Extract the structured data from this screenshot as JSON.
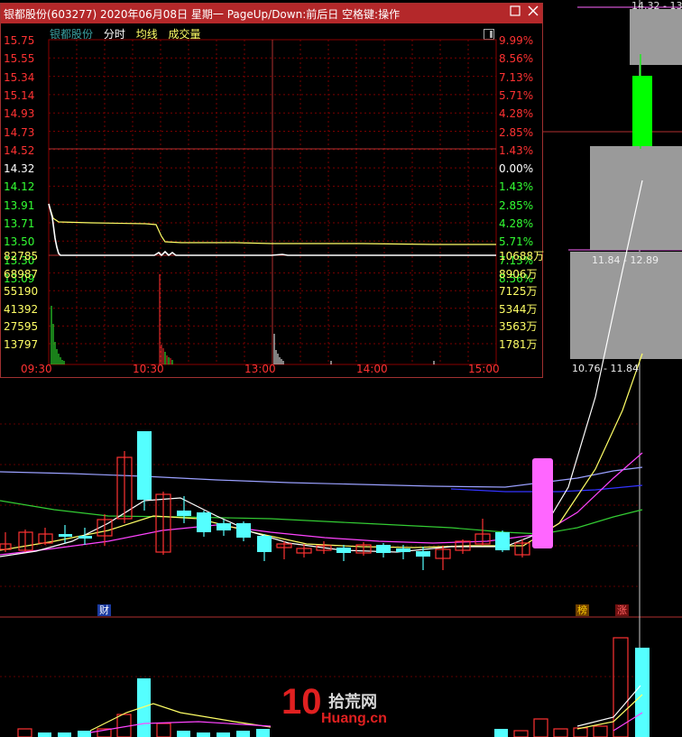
{
  "window": {
    "title": "银都股份(603277) 2020年06月08日 星期一 PageUp/Down:前后日 空格键:操作",
    "maximize_icon": "square-icon",
    "close_icon": "x-icon"
  },
  "legend": {
    "stock_name": "银都股份",
    "fenshi": "分时",
    "avg_line": "均线",
    "volume": "成交量"
  },
  "intraday": {
    "price_ticks": [
      "15.75",
      "15.55",
      "15.34",
      "15.14",
      "14.93",
      "14.73",
      "14.52",
      "14.32",
      "14.12",
      "13.91",
      "13.71",
      "13.50",
      "13.30",
      "13.09"
    ],
    "pct_ticks": [
      "9.99%",
      "8.56%",
      "7.13%",
      "5.71%",
      "4.28%",
      "2.85%",
      "1.43%",
      "0.00%",
      "1.43%",
      "2.85%",
      "4.28%",
      "5.71%",
      "7.13%",
      "8.56%"
    ],
    "vol_ticks_left": [
      "82785",
      "68987",
      "55190",
      "41392",
      "27595",
      "13797"
    ],
    "vol_ticks_right": [
      "10688万",
      "8906万",
      "7125万",
      "5344万",
      "3563万",
      "1781万"
    ],
    "time_ticks": [
      "09:30",
      "10:30",
      "13:00",
      "14:00",
      "15:00"
    ]
  },
  "right_panel": {
    "top_label": "14.32 - 13",
    "mid_label": "11.84 - 12.89",
    "bottom_label": "10.76 - 11.84"
  },
  "markers": {
    "cai": "财",
    "bang": "榜",
    "zhang": "涨"
  },
  "watermark": {
    "number": "10",
    "cn": "拾荒网",
    "en": "Huang.cn"
  },
  "colors": {
    "up": "#ff3232",
    "down": "#54ffff",
    "limit_up": "#ff66ff",
    "grid": "#7a0000",
    "price_line": "#ffffff",
    "avg_line": "#ffff66"
  }
}
